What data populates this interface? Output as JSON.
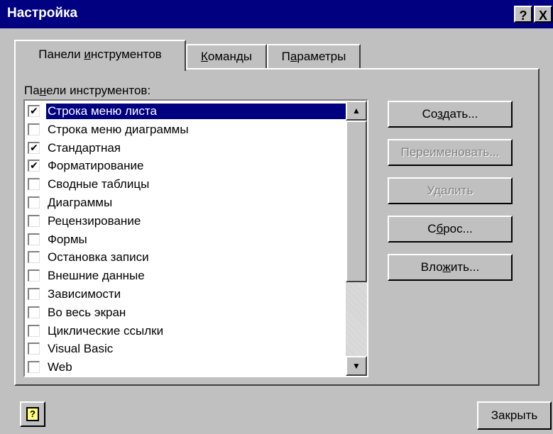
{
  "window": {
    "title": "Настройка",
    "help_label": "?",
    "close_label": "X"
  },
  "tabs": [
    {
      "label_pre": "Панели ",
      "label_key": "и",
      "label_post": "нструментов"
    },
    {
      "label_pre": "",
      "label_key": "К",
      "label_post": "оманды"
    },
    {
      "label_pre": "П",
      "label_key": "а",
      "label_post": "раметры"
    }
  ],
  "toolbars_panel": {
    "label_pre": "Па",
    "label_key": "н",
    "label_post": "ели инструментов:",
    "items": [
      {
        "label": "Строка меню листа",
        "checked": true,
        "selected": true
      },
      {
        "label": "Строка меню диаграммы",
        "checked": false,
        "selected": false
      },
      {
        "label": "Стандартная",
        "checked": true,
        "selected": false
      },
      {
        "label": "Форматирование",
        "checked": true,
        "selected": false
      },
      {
        "label": "Сводные таблицы",
        "checked": false,
        "selected": false
      },
      {
        "label": "Диаграммы",
        "checked": false,
        "selected": false
      },
      {
        "label": "Рецензирование",
        "checked": false,
        "selected": false
      },
      {
        "label": "Формы",
        "checked": false,
        "selected": false
      },
      {
        "label": "Остановка записи",
        "checked": false,
        "selected": false
      },
      {
        "label": "Внешние данные",
        "checked": false,
        "selected": false
      },
      {
        "label": "Зависимости",
        "checked": false,
        "selected": false
      },
      {
        "label": "Во весь экран",
        "checked": false,
        "selected": false
      },
      {
        "label": "Циклические ссылки",
        "checked": false,
        "selected": false
      },
      {
        "label": "Visual Basic",
        "checked": false,
        "selected": false
      },
      {
        "label": "Web",
        "checked": false,
        "selected": false
      }
    ]
  },
  "buttons": {
    "create": {
      "pre": "Со",
      "key": "з",
      "post": "дать..."
    },
    "rename": {
      "label": "Переименовать..."
    },
    "delete": {
      "label": "Удалить"
    },
    "reset": {
      "pre": "С",
      "key": "б",
      "post": "рос..."
    },
    "attach": {
      "pre": "Вло",
      "key": "ж",
      "post": "ить..."
    }
  },
  "footer": {
    "help_icon_glyph": "?",
    "close_label": "Закрыть"
  }
}
